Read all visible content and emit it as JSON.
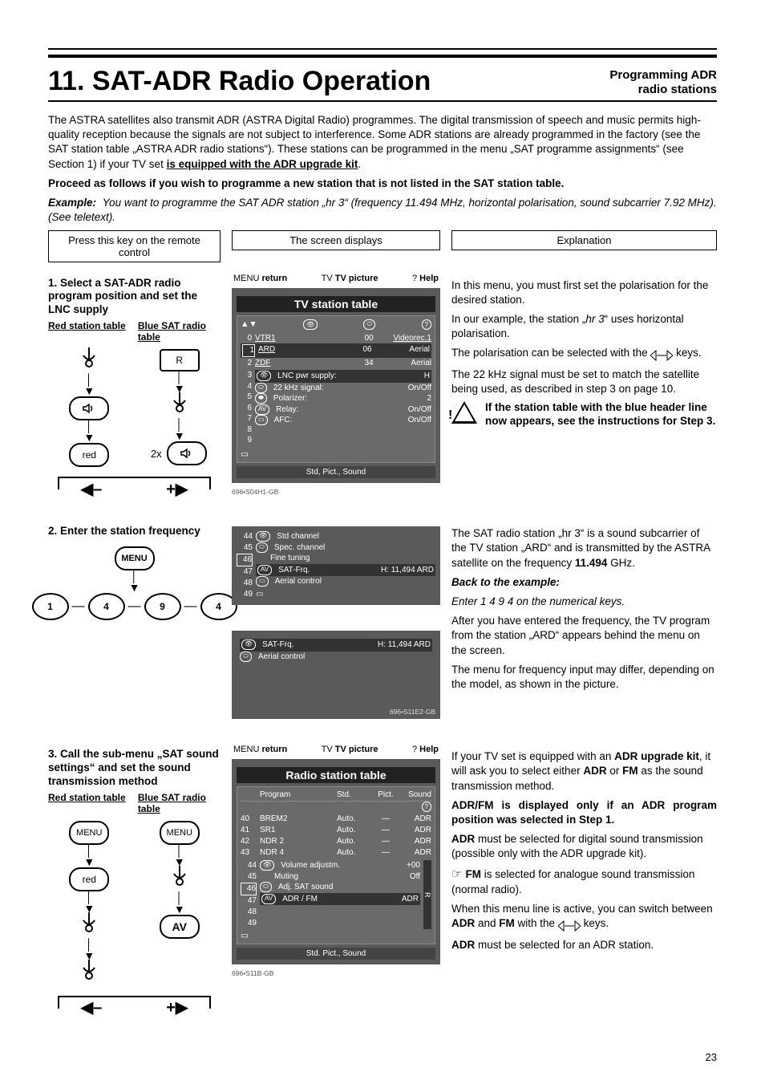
{
  "header": {
    "title": "11. SAT-ADR Radio Operation",
    "subtitle_line1": "Programming ADR",
    "subtitle_line2": "radio stations"
  },
  "intro": {
    "p1_a": "The ASTRA satellites also transmit ADR (ASTRA Digital Radio) programmes. The digital transmission of speech and music permits high-quality reception because the signals are not subject to interference. Some ADR stations are already programmed in the factory (see the SAT station table „ASTRA ADR radio stations“). These stations can be programmed in the menu „SAT programme assignments“ (see Section 1) if your TV set ",
    "p1_ul": "is equipped with the ADR upgrade kit",
    "p1_end": ".",
    "p2": "Proceed as follows if you wish to programme a new station that is not listed in the SAT station table.",
    "ex_label": "Example:",
    "ex_text": "You want to programme the SAT ADR station „hr 3“ (frequency 11.494 MHz, horizontal polarisation, sound subcarrier 7.92 MHz). (See teletext)."
  },
  "col_headers": {
    "left": "Press this key on the remote control",
    "mid": "The screen displays",
    "right": "Explanation"
  },
  "step1": {
    "heading": "1. Select a SAT-ADR radio program position and set the LNC supply",
    "red_label": "Red station table",
    "blue_label": "Blue SAT radio table",
    "remote_R": "R",
    "remote_red": "red",
    "remote_2x": "2x",
    "minus": "–",
    "plus": "+",
    "screen": {
      "return": "return",
      "tv_picture": "TV picture",
      "help": "Help",
      "title": "TV station table",
      "rows": [
        {
          "n": "0",
          "name": "VTR1",
          "a": "00",
          "b": "Videorec.1"
        },
        {
          "n": "1",
          "name": "ARD",
          "a": "06",
          "b": "Aerial"
        },
        {
          "n": "2",
          "name": "ZDF",
          "a": "34",
          "b": "Aerial"
        }
      ],
      "sidenums": [
        "3",
        "4",
        "5",
        "6",
        "7",
        "8",
        "9"
      ],
      "settings": [
        {
          "icon": "eye",
          "label": "LNC pwr supply:",
          "val": "H"
        },
        {
          "icon": "oval",
          "label": "22 kHz signal:",
          "val": "On/Off"
        },
        {
          "icon": "oval2",
          "label": "Polarizer:",
          "val": "2"
        },
        {
          "icon": "av",
          "label": "Relay:",
          "val": "On/Off"
        },
        {
          "icon": "rect",
          "label": "AFC:",
          "val": "On/Off"
        }
      ],
      "foot": "Std, Pict., Sound",
      "code": "696•S04H1-GB"
    },
    "right": {
      "p1": "In this menu, you must first set the polarisation for the desired station.",
      "p2_a": "In our example, the station „",
      "p2_i": "hr 3",
      "p2_b": "“ uses horizontal polarisation.",
      "p3_a": "The polarisation can be selected with the ",
      "p3_b": " keys.",
      "p4": "The 22 kHz signal must be set to match the satellite being used, as described in step 3 on page 10.",
      "warn": "If the station table with the blue header line now appears, see the instructions for Step 3."
    }
  },
  "step2": {
    "heading": "2. Enter the station frequency",
    "menu": "MENU",
    "digits": [
      "1",
      "4",
      "9",
      "4"
    ],
    "screen_a": {
      "sidenums": [
        "44",
        "45",
        "46",
        "47",
        "48",
        "49"
      ],
      "lines": [
        {
          "icon": "eye",
          "label": "Std channel"
        },
        {
          "icon": "oval",
          "label": "Spec. channel"
        },
        {
          "icon": "",
          "label": "Fine tuning"
        },
        {
          "icon": "av",
          "label": "SAT-Frq.",
          "val": "H: 11,494 ARD"
        },
        {
          "icon": "rect",
          "label": "Aerial control"
        }
      ],
      "selected_row": 2
    },
    "screen_b": {
      "lines": [
        {
          "icon": "eye",
          "label": "SAT-Frq.",
          "val": "H: 11,494 ARD"
        },
        {
          "icon": "oval",
          "label": "Aerial control"
        }
      ],
      "code": "696•S11E2-GB"
    },
    "right": {
      "p1_a": "The SAT radio station „hr 3“ is a sound subcarrier of the TV station „ARD“ and is transmitted by the ASTRA satellite on the frequency ",
      "p1_b": "11.494",
      "p1_c": " GHz.",
      "back_label": "Back to the example:",
      "back_line": "Enter 1 4 9 4 on the numerical keys.",
      "p2": "After you have entered the frequency, the TV program from the station „ARD“ appears behind the menu on the screen.",
      "p3": "The menu for frequency input may differ, depending on the model, as shown in the picture."
    }
  },
  "step3": {
    "heading": "3. Call the sub-menu „SAT sound settings“ and set the sound transmission method",
    "red_label": "Red station table",
    "blue_label": "Blue SAT radio table",
    "menu": "MENU",
    "red": "red",
    "av": "AV",
    "screen": {
      "return": "return",
      "tv_picture": "TV picture",
      "help": "Help",
      "title": "Radio station table",
      "head": [
        "",
        "Program",
        "Std.",
        "Pict.",
        "Sound"
      ],
      "rows": [
        {
          "n": "40",
          "name": "BREM2",
          "std": "Auto.",
          "pict": "—",
          "sound": "ADR"
        },
        {
          "n": "41",
          "name": "SR1",
          "std": "Auto.",
          "pict": "—",
          "sound": "ADR"
        },
        {
          "n": "42",
          "name": "NDR 2",
          "std": "Auto.",
          "pict": "—",
          "sound": "ADR"
        },
        {
          "n": "43",
          "name": "NDR 4",
          "std": "Auto.",
          "pict": "—",
          "sound": "ADR"
        }
      ],
      "sidenums": [
        "44",
        "45",
        "46",
        "47",
        "48",
        "49"
      ],
      "settings": [
        {
          "icon": "eye",
          "label": "Volume adjustm.",
          "val": "+00"
        },
        {
          "icon": "",
          "label": "Muting",
          "val": "Off"
        },
        {
          "icon": "oval",
          "label": "Adj. SAT sound",
          "val": ""
        },
        {
          "icon": "av",
          "label": "ADR / FM",
          "val": "ADR"
        }
      ],
      "foot": "Std. Pict., Sound",
      "code": "696•S11B-GB",
      "side_R": "R"
    },
    "right": {
      "p1_a": "If your TV set is equipped with an ",
      "p1_b": "ADR upgrade kit",
      "p1_c": ", it will ask you to select either ",
      "p1_d": "ADR",
      "p1_e": " or ",
      "p1_f": "FM",
      "p1_g": " as the sound transmission method.",
      "p2": "ADR/FM is displayed only if an ADR program position was selected in Step 1.",
      "p3_a": "ADR",
      "p3_b": " must be selected for digital sound transmission (possible only with the ADR upgrade kit).",
      "p4_a": "FM",
      "p4_b": " is selected for analogue sound transmission (normal radio).",
      "p5_a": "When this menu line is active, you can switch between ",
      "p5_b": "ADR",
      "p5_c": " and ",
      "p5_d": "FM",
      "p5_e": " with the ",
      "p5_f": " keys.",
      "p6_a": "ADR",
      "p6_b": "  must be selected for an ADR station."
    }
  },
  "page_number": "23"
}
